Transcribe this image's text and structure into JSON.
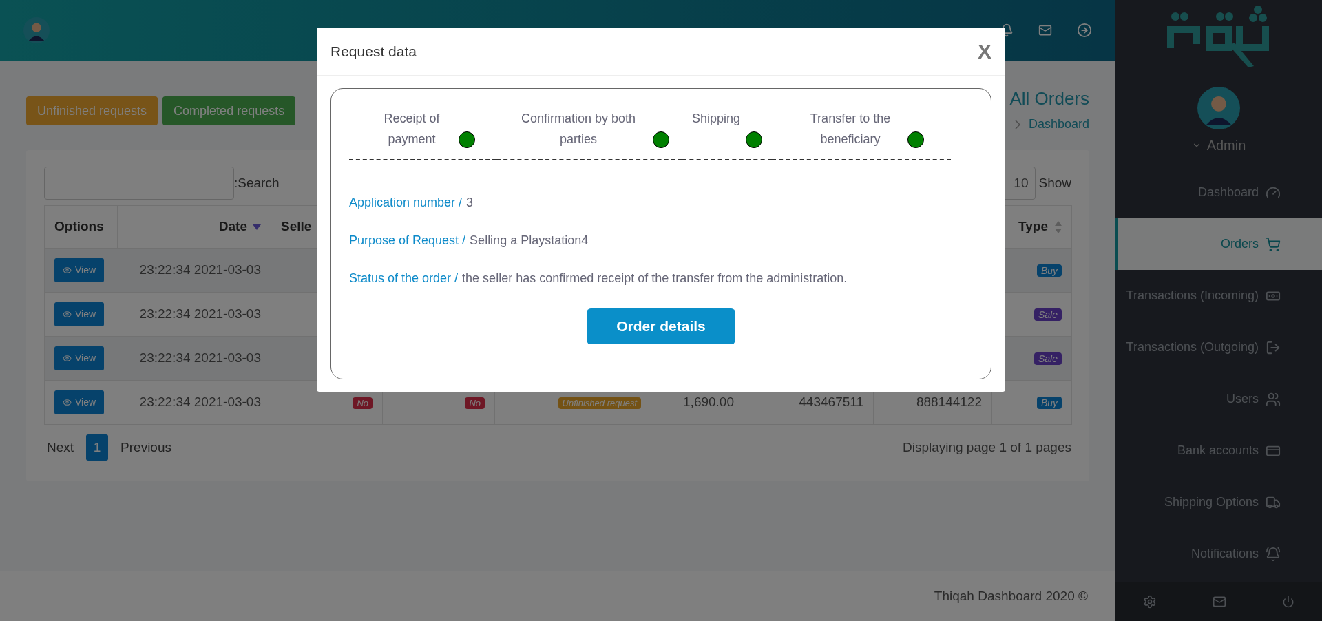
{
  "header": {
    "page_title": "All Orders",
    "breadcrumb": "Dashboard"
  },
  "filter_buttons": [
    {
      "label": "Unfinished requests",
      "kind": "warning"
    },
    {
      "label": "Completed requests",
      "kind": "success"
    }
  ],
  "search": {
    "label": ":Search"
  },
  "page_size": {
    "value": "10",
    "label": "Show"
  },
  "table": {
    "columns": [
      {
        "label": "Options"
      },
      {
        "label": "Date",
        "sorted": true
      },
      {
        "label": "Selle"
      },
      {
        "label": "Type",
        "sorted": false
      }
    ],
    "rows": [
      {
        "action": "View",
        "date": "23:22:34 2021-03-03",
        "type": {
          "label": "Buy",
          "kind": "buy"
        }
      },
      {
        "action": "View",
        "date": "23:22:34 2021-03-03",
        "type": {
          "label": "Sale",
          "kind": "sale"
        }
      },
      {
        "action": "View",
        "date": "23:22:34 2021-03-03",
        "type": {
          "label": "Sale",
          "kind": "sale"
        }
      },
      {
        "action": "View",
        "date": "23:22:34 2021-03-03",
        "cells": [
          {
            "text": "No",
            "kind": "danger"
          },
          {
            "text": "No",
            "kind": "danger"
          },
          {
            "text": "Unfinished request",
            "kind": "warning"
          },
          {
            "text": "1,690.00",
            "kind": "text"
          },
          {
            "text": "443467511",
            "kind": "text"
          },
          {
            "text": "888144122",
            "kind": "text"
          }
        ],
        "type": {
          "label": "Buy",
          "kind": "buy"
        }
      }
    ]
  },
  "pagination": {
    "buttons": [
      {
        "label": "Next",
        "kind": "link",
        "selected": false
      },
      {
        "label": "1",
        "kind": "page",
        "selected": true
      },
      {
        "label": "Previous",
        "kind": "link",
        "selected": false
      }
    ],
    "info": "Displaying page 1 of 1 pages"
  },
  "footer": "Thiqah Dashboard 2020 ©",
  "sidebar": {
    "user": "Admin",
    "items": [
      {
        "label": "Dashboard",
        "selected": false
      },
      {
        "label": "Orders",
        "selected": true
      },
      {
        "label": "Transactions (Incoming)",
        "selected": false
      },
      {
        "label": "Transactions (Outgoing)",
        "selected": false
      },
      {
        "label": "Users",
        "selected": false
      },
      {
        "label": "Bank accounts",
        "selected": false
      },
      {
        "label": "Shipping Options",
        "selected": false
      },
      {
        "label": "Notifications",
        "selected": false
      }
    ]
  },
  "modal": {
    "title": "Request data",
    "close": "X",
    "steps": [
      {
        "label": "Receipt of payment",
        "done": true
      },
      {
        "label": "Confirmation by both parties",
        "done": true
      },
      {
        "label": "Shipping",
        "done": true
      },
      {
        "label": "Transfer to the beneficiary",
        "done": true
      }
    ],
    "fields": [
      {
        "label": "Application number /",
        "value": "3"
      },
      {
        "label": "Purpose of Request /",
        "value": "Selling a Playstation4"
      },
      {
        "label": "Status of the order /",
        "value": "the seller has confirmed receipt of the transfer from the administration."
      }
    ],
    "button": "Order details"
  }
}
